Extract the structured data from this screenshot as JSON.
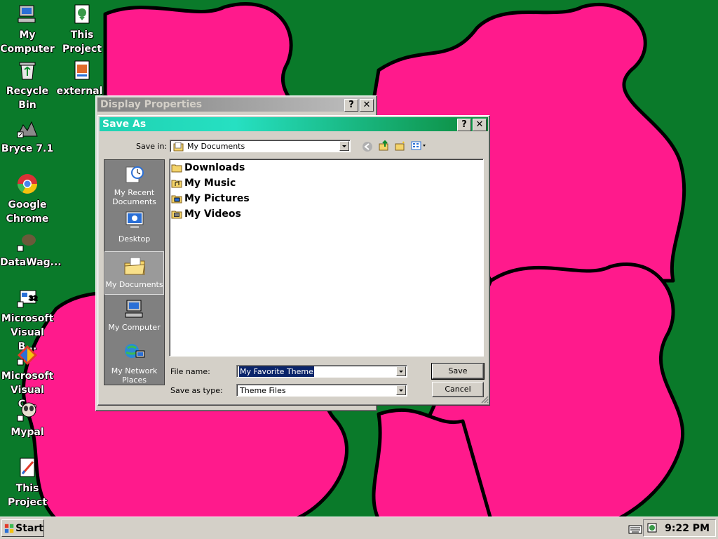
{
  "desktop": {
    "icons": [
      {
        "label_line1": "My",
        "label_line2": "Computer",
        "icon": "my-computer-icon"
      },
      {
        "label_line1": "This",
        "label_line2": "Project",
        "icon": "project-icon"
      },
      {
        "label_line1": "Recycle",
        "label_line2": "Bin",
        "icon": "recycle-bin-icon"
      },
      {
        "label_line1": "external_",
        "label_line2": "",
        "icon": "document-icon"
      },
      {
        "label_line1": "Bryce 7.1",
        "label_line2": "",
        "icon": "bryce-shortcut-icon"
      },
      {
        "label_line1": "Google",
        "label_line2": "Chrome",
        "icon": "chrome-icon"
      },
      {
        "label_line1": "DataWag...",
        "label_line2": "",
        "icon": "datawag-shortcut-icon"
      },
      {
        "label_line1": "Microsoft",
        "label_line2": "Visual B...",
        "icon": "visual-basic-icon"
      },
      {
        "label_line1": "Microsoft",
        "label_line2": "Visual C...",
        "icon": "visual-c-icon"
      },
      {
        "label_line1": "Mypal",
        "label_line2": "",
        "icon": "mypal-icon"
      },
      {
        "label_line1": "This",
        "label_line2": "Project",
        "icon": "project-file-icon"
      }
    ]
  },
  "display_properties": {
    "title": "Display Properties",
    "help_label": "?",
    "close_label": "✕"
  },
  "save_as": {
    "title": "Save As",
    "help_label": "?",
    "close_label": "✕",
    "save_in_label": "Save in:",
    "save_in_value": "My Documents",
    "places": [
      {
        "label_line1": "My Recent",
        "label_line2": "Documents",
        "icon": "recent-documents-icon"
      },
      {
        "label_line1": "Desktop",
        "label_line2": "",
        "icon": "desktop-icon"
      },
      {
        "label_line1": "My Documents",
        "label_line2": "",
        "icon": "my-documents-icon",
        "selected": true
      },
      {
        "label_line1": "My Computer",
        "label_line2": "",
        "icon": "my-computer-icon"
      },
      {
        "label_line1": "My Network",
        "label_line2": "Places",
        "icon": "network-places-icon"
      }
    ],
    "files": [
      "Downloads",
      "My Music",
      "My Pictures",
      "My Videos"
    ],
    "file_name_label": "File name:",
    "file_name_value": "My Favorite Theme",
    "save_as_type_label": "Save as type:",
    "save_as_type_value": "Theme Files",
    "save_button": "Save",
    "cancel_button": "Cancel"
  },
  "taskbar": {
    "start_label": "Start",
    "clock": "9:22 PM"
  },
  "colors": {
    "desktop_bg": "#0a7a2a",
    "wallpaper_pink": "#ff1a8c",
    "active_title": "#1fd2b2",
    "dialog_face": "#d4d0c8"
  }
}
